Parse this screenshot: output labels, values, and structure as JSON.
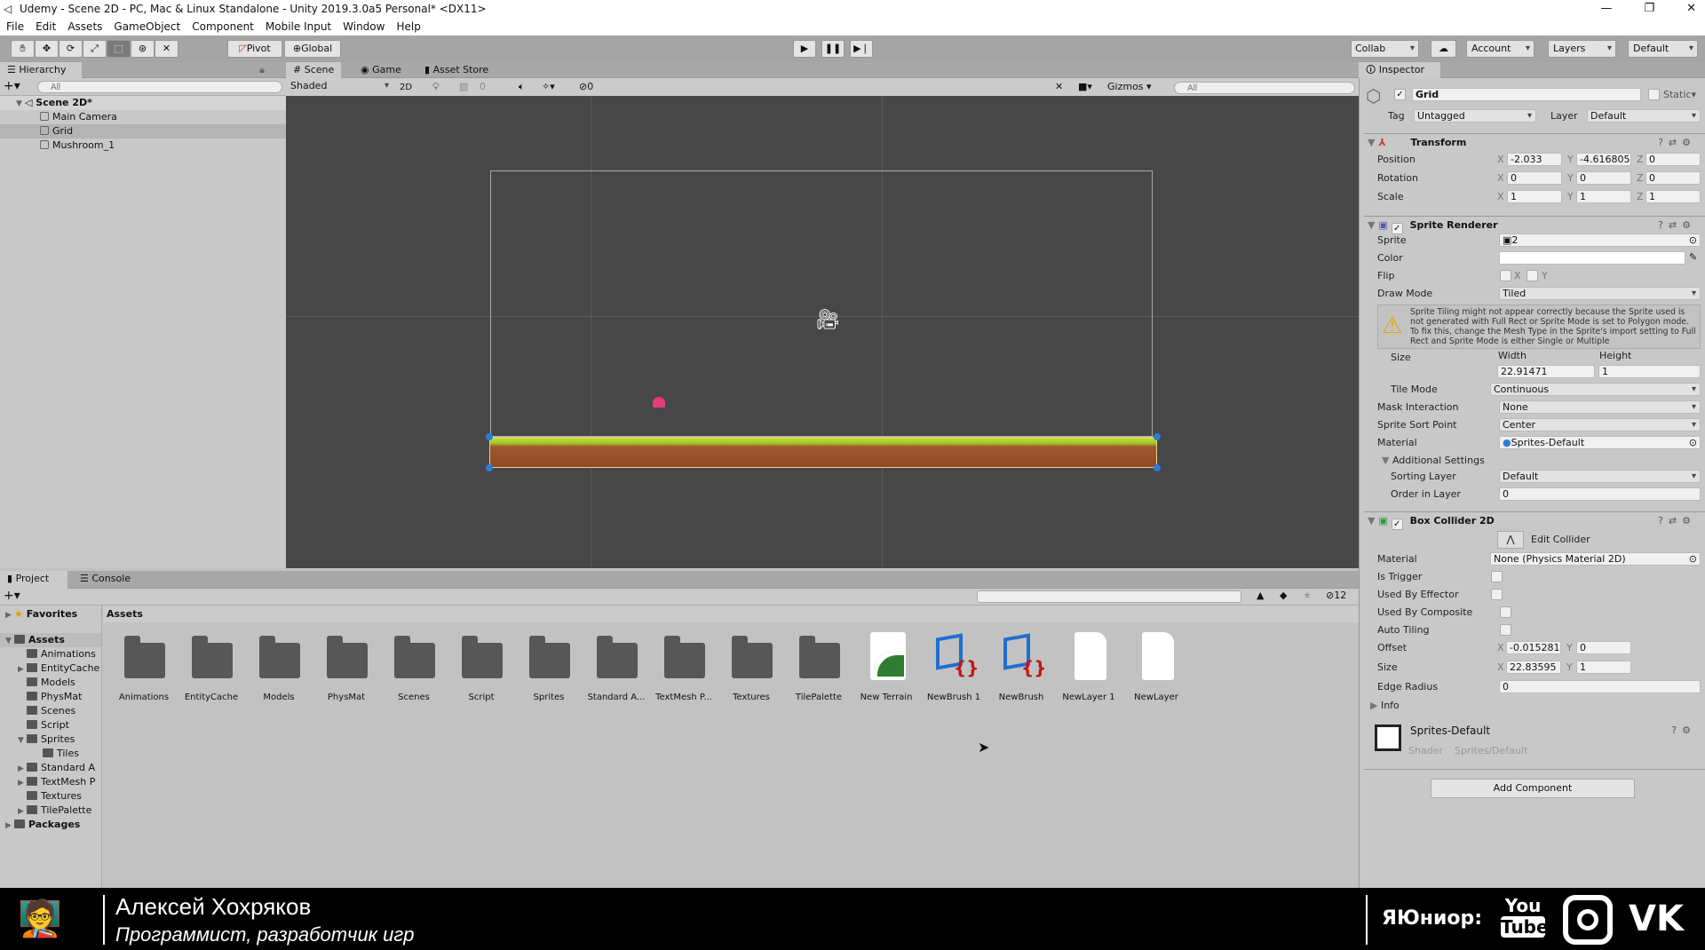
{
  "window": {
    "title": "Udemy - Scene 2D - PC, Mac & Linux Standalone - Unity 2019.3.0a5 Personal* <DX11>",
    "controls": [
      "—",
      "❐",
      "✕"
    ]
  },
  "menu": [
    "File",
    "Edit",
    "Assets",
    "GameObject",
    "Component",
    "Mobile Input",
    "Window",
    "Help"
  ],
  "toolbar": {
    "tools": [
      "hand-tool",
      "move-tool",
      "rotate-tool",
      "scale-tool",
      "rect-tool",
      "transform-tool",
      "custom-tool"
    ],
    "active_tool": "rect-tool",
    "pivot": "Pivot",
    "global": "Global",
    "collab": "Collab",
    "account": "Account",
    "layers": "Layers",
    "layout": "Default"
  },
  "hierarchy": {
    "tab": "Hierarchy",
    "search_placeholder": "All",
    "scene": "Scene 2D*",
    "items": [
      "Main Camera",
      "Grid",
      "Mushroom_1"
    ],
    "selected": "Grid"
  },
  "scene": {
    "tabs": [
      "Scene",
      "Game",
      "Asset Store"
    ],
    "active_tab": "Scene",
    "shading": "Shaded",
    "mode2d": "2D",
    "fx_count": "0",
    "hidden_count": "0",
    "gizmos": "Gizmos",
    "search_placeholder": "All"
  },
  "inspector": {
    "tab": "Inspector",
    "object_name": "Grid",
    "static_label": "Static",
    "tag_label": "Tag",
    "tag": "Untagged",
    "layer_label": "Layer",
    "layer": "Default",
    "transform": {
      "title": "Transform",
      "rows": [
        {
          "label": "Position",
          "x": "-2.033",
          "y": "-4.616805",
          "z": "0"
        },
        {
          "label": "Rotation",
          "x": "0",
          "y": "0",
          "z": "0"
        },
        {
          "label": "Scale",
          "x": "1",
          "y": "1",
          "z": "1"
        }
      ]
    },
    "sprite_renderer": {
      "title": "Sprite Renderer",
      "sprite_label": "Sprite",
      "sprite": "2",
      "color_label": "Color",
      "color": "#ffffff",
      "flip_label": "Flip",
      "flip_x": "X",
      "flip_y": "Y",
      "draw_mode_label": "Draw Mode",
      "draw_mode": "Tiled",
      "warning": "Sprite Tiling might not appear correctly because the Sprite used is not generated with Full Rect or Sprite Mode is set to Polygon mode. To fix this, change the Mesh Type in the Sprite's import setting to Full Rect and Sprite Mode is either Single or Multiple",
      "size_label": "Size",
      "width_label": "Width",
      "height_label": "Height",
      "width": "22.91471",
      "height": "1",
      "tile_mode_label": "Tile Mode",
      "tile_mode": "Continuous",
      "mask_label": "Mask Interaction",
      "mask": "None",
      "sort_point_label": "Sprite Sort Point",
      "sort_point": "Center",
      "material_label": "Material",
      "material": "Sprites-Default",
      "additional": "Additional Settings",
      "sorting_layer_label": "Sorting Layer",
      "sorting_layer": "Default",
      "order_label": "Order in Layer",
      "order": "0"
    },
    "box_collider": {
      "title": "Box Collider 2D",
      "edit": "Edit Collider",
      "material_label": "Material",
      "material": "None (Physics Material 2D)",
      "is_trigger": "Is Trigger",
      "used_by_effector": "Used By Effector",
      "used_by_composite": "Used By Composite",
      "auto_tiling": "Auto Tiling",
      "offset_label": "Offset",
      "offset_x": "-0.015281",
      "offset_y": "0",
      "size_label": "Size",
      "size_x": "22.83595",
      "size_y": "1",
      "edge_label": "Edge Radius",
      "edge": "0",
      "info": "Info"
    },
    "material": {
      "name": "Sprites-Default",
      "shader_label": "Shader",
      "shader": "Sprites/Default"
    },
    "add_component": "Add Component"
  },
  "project": {
    "tabs": [
      "Project",
      "Console"
    ],
    "hidden_count": "12",
    "favorites": "Favorites",
    "assets_root": "Assets",
    "packages": "Packages",
    "tree": [
      {
        "name": "Animations",
        "arrow": ""
      },
      {
        "name": "EntityCache",
        "arrow": "▶"
      },
      {
        "name": "Models",
        "arrow": ""
      },
      {
        "name": "PhysMat",
        "arrow": ""
      },
      {
        "name": "Scenes",
        "arrow": ""
      },
      {
        "name": "Script",
        "arrow": ""
      },
      {
        "name": "Sprites",
        "arrow": "▼"
      },
      {
        "name": "Tiles",
        "arrow": "",
        "indent": true
      },
      {
        "name": "Standard A",
        "arrow": "▶"
      },
      {
        "name": "TextMesh P",
        "arrow": "▶"
      },
      {
        "name": "Textures",
        "arrow": ""
      },
      {
        "name": "TilePalette",
        "arrow": "▶"
      }
    ],
    "breadcrumb": "Assets",
    "assets": [
      {
        "name": "Animations",
        "type": "folder"
      },
      {
        "name": "EntityCache",
        "type": "folder"
      },
      {
        "name": "Models",
        "type": "folder"
      },
      {
        "name": "PhysMat",
        "type": "folder"
      },
      {
        "name": "Scenes",
        "type": "folder"
      },
      {
        "name": "Script",
        "type": "folder"
      },
      {
        "name": "Sprites",
        "type": "folder"
      },
      {
        "name": "Standard A...",
        "type": "folder"
      },
      {
        "name": "TextMesh P...",
        "type": "folder"
      },
      {
        "name": "Textures",
        "type": "folder"
      },
      {
        "name": "TilePalette",
        "type": "folder"
      },
      {
        "name": "New Terrain",
        "type": "terrain"
      },
      {
        "name": "NewBrush 1",
        "type": "brush"
      },
      {
        "name": "NewBrush",
        "type": "brush"
      },
      {
        "name": "NewLayer 1",
        "type": "file"
      },
      {
        "name": "NewLayer",
        "type": "file"
      }
    ]
  },
  "footer": {
    "name": "Алексей Хохряков",
    "role": "Программист, разработчик игр",
    "brand": "ЯЮниор:",
    "youtube_you": "You",
    "youtube_tube": "Tube",
    "vk": "VK"
  }
}
